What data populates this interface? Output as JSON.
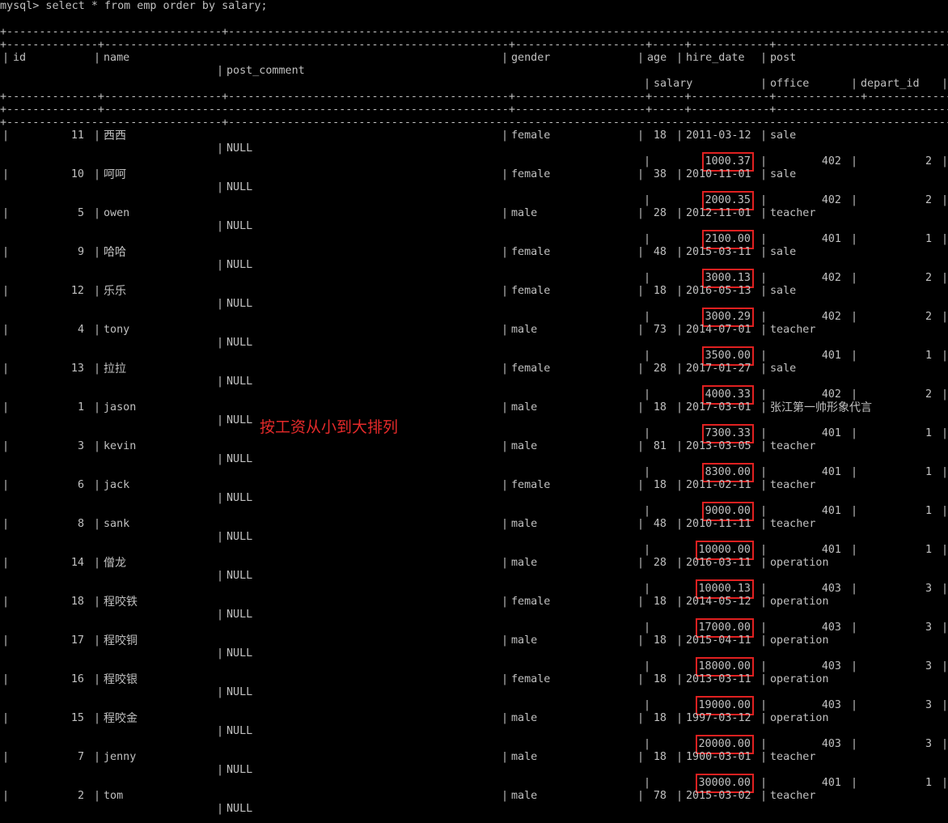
{
  "prompt": "mysql> select * from emp order by salary;",
  "separator_dash": "-",
  "separator_plus": "+",
  "headers": {
    "id": "id",
    "name": "name",
    "post_comment": "post_comment",
    "gender": "gender",
    "age": "age",
    "hire_date": "hire_date",
    "post": "post",
    "salary": "salary",
    "office": "office",
    "depart_id": "depart_id"
  },
  "rows": [
    {
      "id": "11",
      "name": "西西",
      "gender": "female",
      "age": "18",
      "hire_date": "2011-03-12",
      "post": "sale",
      "post_comment": "NULL",
      "salary": "1000.37",
      "office": "402",
      "depart_id": "2"
    },
    {
      "id": "10",
      "name": "呵呵",
      "gender": "female",
      "age": "38",
      "hire_date": "2010-11-01",
      "post": "sale",
      "post_comment": "NULL",
      "salary": "2000.35",
      "office": "402",
      "depart_id": "2"
    },
    {
      "id": "5",
      "name": "owen",
      "gender": "male",
      "age": "28",
      "hire_date": "2012-11-01",
      "post": "teacher",
      "post_comment": "NULL",
      "salary": "2100.00",
      "office": "401",
      "depart_id": "1"
    },
    {
      "id": "9",
      "name": "哈哈",
      "gender": "female",
      "age": "48",
      "hire_date": "2015-03-11",
      "post": "sale",
      "post_comment": "NULL",
      "salary": "3000.13",
      "office": "402",
      "depart_id": "2"
    },
    {
      "id": "12",
      "name": "乐乐",
      "gender": "female",
      "age": "18",
      "hire_date": "2016-05-13",
      "post": "sale",
      "post_comment": "NULL",
      "salary": "3000.29",
      "office": "402",
      "depart_id": "2"
    },
    {
      "id": "4",
      "name": "tony",
      "gender": "male",
      "age": "73",
      "hire_date": "2014-07-01",
      "post": "teacher",
      "post_comment": "NULL",
      "salary": "3500.00",
      "office": "401",
      "depart_id": "1"
    },
    {
      "id": "13",
      "name": "拉拉",
      "gender": "female",
      "age": "28",
      "hire_date": "2017-01-27",
      "post": "sale",
      "post_comment": "NULL",
      "salary": "4000.33",
      "office": "402",
      "depart_id": "2"
    },
    {
      "id": "1",
      "name": "jason",
      "gender": "male",
      "age": "18",
      "hire_date": "2017-03-01",
      "post": "张江第一帅形象代言",
      "post_comment": "NULL",
      "salary": "7300.33",
      "office": "401",
      "depart_id": "1"
    },
    {
      "id": "3",
      "name": "kevin",
      "gender": "male",
      "age": "81",
      "hire_date": "2013-03-05",
      "post": "teacher",
      "post_comment": "NULL",
      "salary": "8300.00",
      "office": "401",
      "depart_id": "1"
    },
    {
      "id": "6",
      "name": "jack",
      "gender": "female",
      "age": "18",
      "hire_date": "2011-02-11",
      "post": "teacher",
      "post_comment": "NULL",
      "salary": "9000.00",
      "office": "401",
      "depart_id": "1"
    },
    {
      "id": "8",
      "name": "sank",
      "gender": "male",
      "age": "48",
      "hire_date": "2010-11-11",
      "post": "teacher",
      "post_comment": "NULL",
      "salary": "10000.00",
      "office": "401",
      "depart_id": "1"
    },
    {
      "id": "14",
      "name": "僧龙",
      "gender": "male",
      "age": "28",
      "hire_date": "2016-03-11",
      "post": "operation",
      "post_comment": "NULL",
      "salary": "10000.13",
      "office": "403",
      "depart_id": "3"
    },
    {
      "id": "18",
      "name": "程咬铁",
      "gender": "female",
      "age": "18",
      "hire_date": "2014-05-12",
      "post": "operation",
      "post_comment": "NULL",
      "salary": "17000.00",
      "office": "403",
      "depart_id": "3"
    },
    {
      "id": "17",
      "name": "程咬铜",
      "gender": "male",
      "age": "18",
      "hire_date": "2015-04-11",
      "post": "operation",
      "post_comment": "NULL",
      "salary": "18000.00",
      "office": "403",
      "depart_id": "3"
    },
    {
      "id": "16",
      "name": "程咬银",
      "gender": "female",
      "age": "18",
      "hire_date": "2013-03-11",
      "post": "operation",
      "post_comment": "NULL",
      "salary": "19000.00",
      "office": "403",
      "depart_id": "3"
    },
    {
      "id": "15",
      "name": "程咬金",
      "gender": "male",
      "age": "18",
      "hire_date": "1997-03-12",
      "post": "operation",
      "post_comment": "NULL",
      "salary": "20000.00",
      "office": "403",
      "depart_id": "3"
    },
    {
      "id": "7",
      "name": "jenny",
      "gender": "male",
      "age": "18",
      "hire_date": "1900-03-01",
      "post": "teacher",
      "post_comment": "NULL",
      "salary": "30000.00",
      "office": "401",
      "depart_id": "1"
    },
    {
      "id": "2",
      "name": "tom",
      "gender": "male",
      "age": "78",
      "hire_date": "2015-03-02",
      "post": "teacher",
      "post_comment": "NULL",
      "salary": "",
      "office": "",
      "depart_id": ""
    }
  ],
  "annotation": "按工资从小到大排列",
  "colors": {
    "background": "#000000",
    "text": "#c0c0c0",
    "highlight": "#e02020",
    "annotation": "#e52a2a"
  }
}
